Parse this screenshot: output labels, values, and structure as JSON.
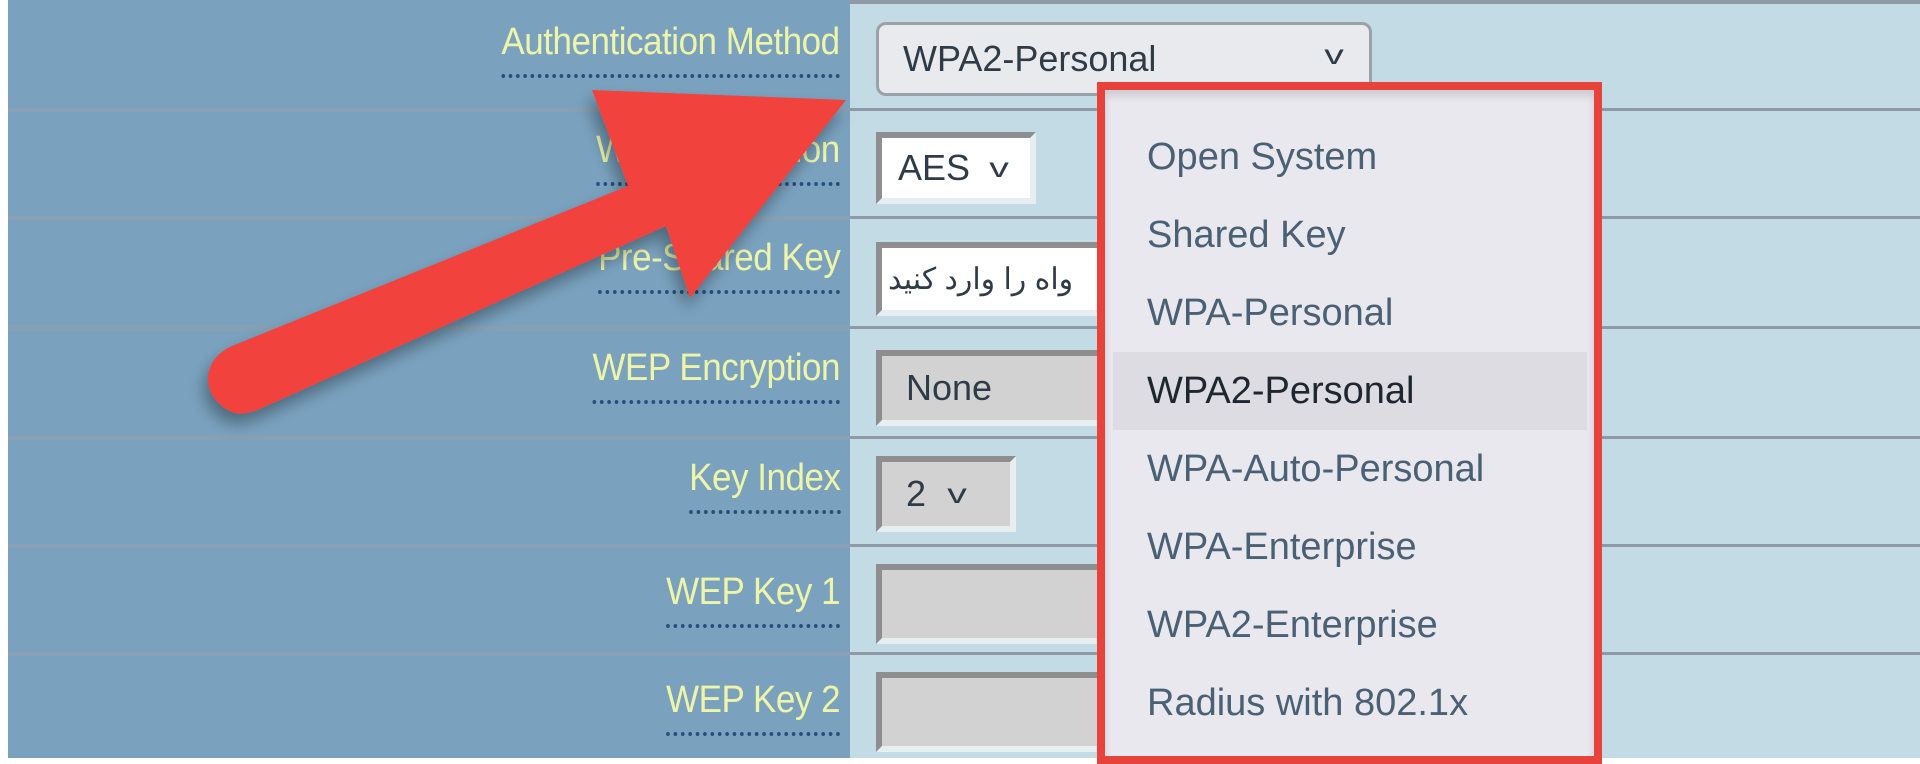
{
  "form": {
    "rows": [
      {
        "label": "Authentication Method",
        "control": "select",
        "value": "WPA2-Personal"
      },
      {
        "label": "WPA Encryption",
        "label_visible_fragment_left": "WPA",
        "label_visible_fragment_right": "on",
        "control": "select",
        "value": "AES"
      },
      {
        "label": "Pre-Shared Key",
        "label_visible_fragment": "re-Sha ed Key",
        "control": "text",
        "value": "واه را وارد کنید"
      },
      {
        "label": "WEP Encryption",
        "control": "select-disabled",
        "value": "None"
      },
      {
        "label": "Key Index",
        "control": "select-disabled",
        "value": "2"
      },
      {
        "label": "WEP Key 1",
        "control": "text-disabled",
        "value": ""
      },
      {
        "label": "WEP Key 2",
        "control": "text-disabled",
        "value": ""
      }
    ]
  },
  "dropdown": {
    "open": true,
    "selected": "WPA2-Personal",
    "options": [
      "Open System",
      "Shared Key",
      "WPA-Personal",
      "WPA2-Personal",
      "WPA-Auto-Personal",
      "WPA-Enterprise",
      "WPA2-Enterprise",
      "Radius with 802.1x"
    ]
  },
  "icons": {
    "chevron": "chevron-down-icon",
    "annotation": "red-arrow-annotation"
  },
  "colors": {
    "label_bg": "#7aa2bf",
    "label_text": "#eef5a8",
    "control_bg": "#c3dbe5",
    "highlight": "#e8423d"
  },
  "chevron_glyph": "v"
}
